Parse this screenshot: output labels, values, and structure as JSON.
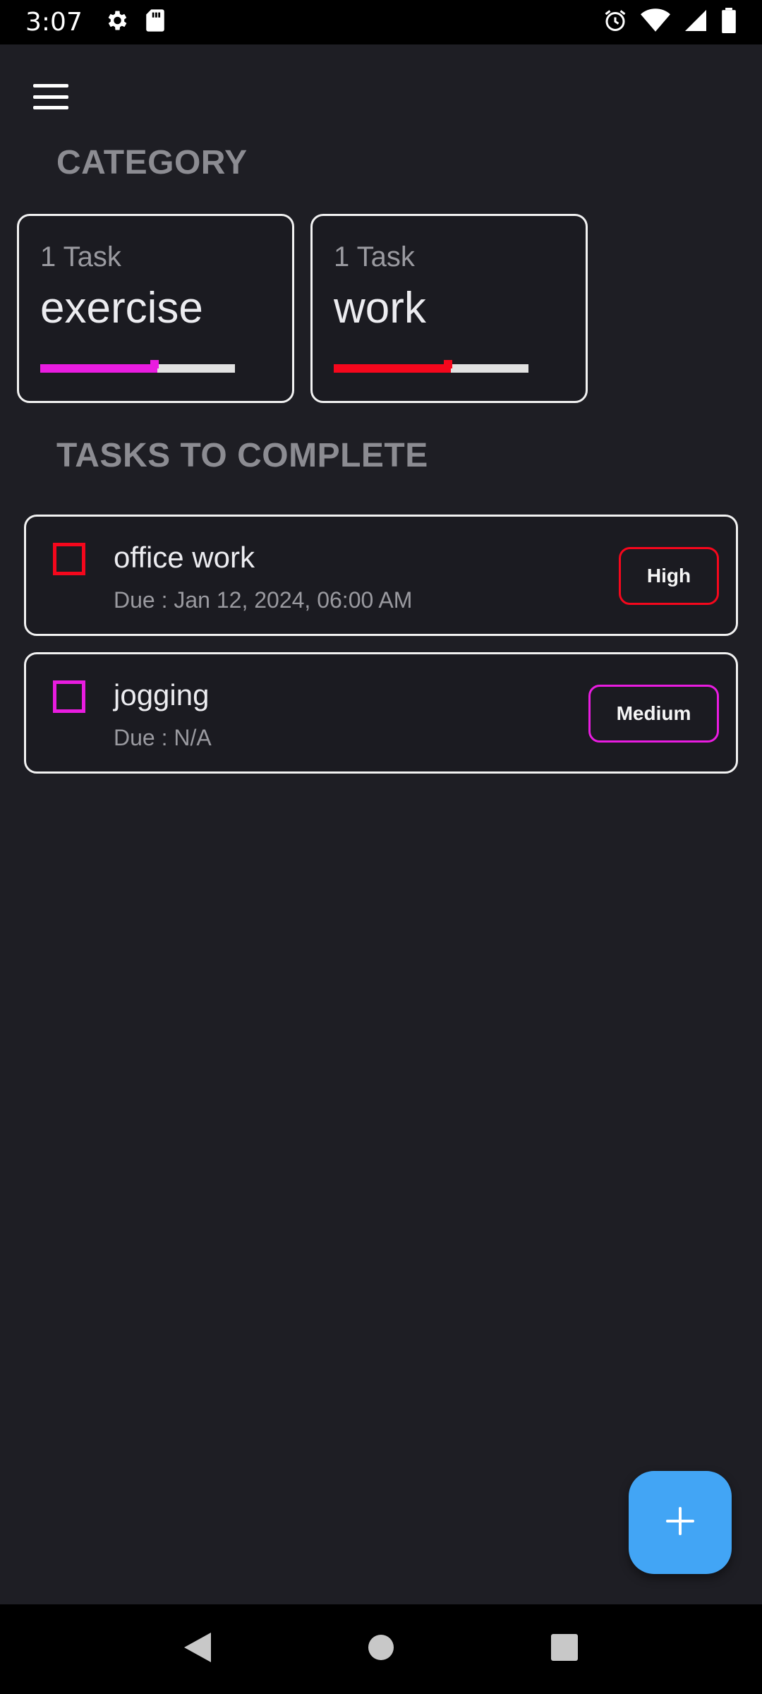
{
  "status_bar": {
    "time": "3:07",
    "left_icons": [
      "gear-icon",
      "sd-card-icon"
    ],
    "right_icons": [
      "alarm-icon",
      "wifi-icon",
      "signal-icon",
      "battery-icon"
    ]
  },
  "header": {
    "menu_icon": "menu-icon"
  },
  "categories_section": {
    "title": "CATEGORY",
    "items": [
      {
        "count": "1 Task",
        "name": "exercise",
        "progress": 0.6,
        "color": "#e91ce0"
      },
      {
        "count": "1 Task",
        "name": "work",
        "progress": 0.6,
        "color": "#f5071c"
      }
    ]
  },
  "tasks_section": {
    "title": "TASKS TO COMPLETE",
    "items": [
      {
        "title": "office work",
        "due": "Due : Jan 12, 2024, 06:00 AM",
        "priority": "High",
        "color": "#f5071c"
      },
      {
        "title": "jogging",
        "due": "Due : N/A",
        "priority": "Medium",
        "color": "#e91ce0"
      }
    ]
  },
  "fab": {
    "icon": "plus-icon",
    "color": "#42a5f5"
  },
  "nav_bar": {
    "icons": [
      "back-icon",
      "home-icon",
      "recents-icon"
    ]
  }
}
